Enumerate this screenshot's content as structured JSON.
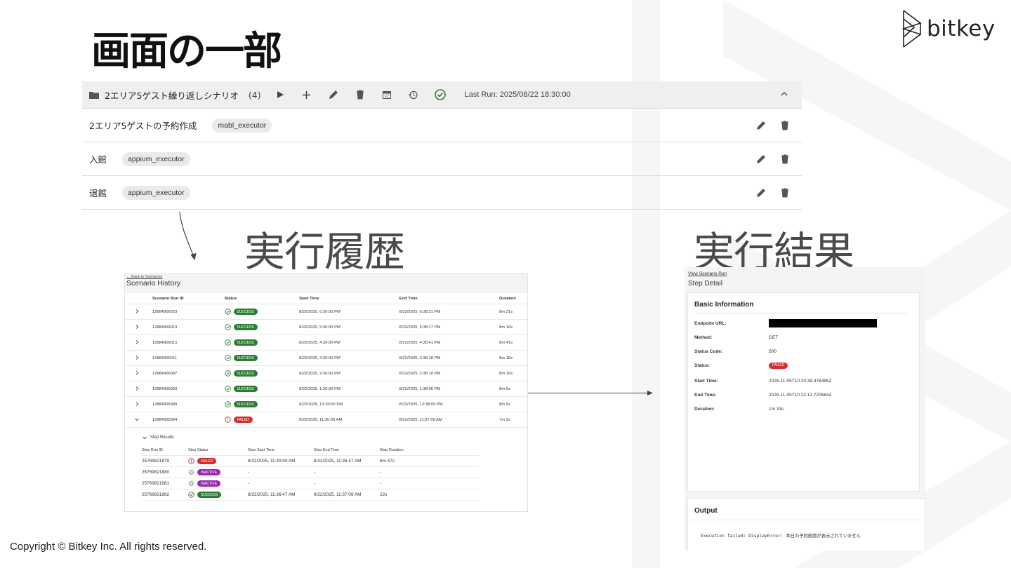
{
  "slide": {
    "title": "画面の一部",
    "logo_text": "bitkey",
    "label_history": "実行履歴",
    "label_result": "実行結果",
    "copyright": "Copyright © Bitkey Inc. All rights reserved."
  },
  "scenario": {
    "group_name": "2エリア5ゲスト繰り返しシナリオ",
    "count": "(4)",
    "last_run": "Last Run: 2025/08/22 18:30:00",
    "rows": [
      {
        "name": "2エリア5ゲストの予約作成",
        "executor": "mabl_executor"
      },
      {
        "name": "入館",
        "executor": "appium_executor"
      },
      {
        "name": "退館",
        "executor": "appium_executor"
      }
    ]
  },
  "history": {
    "back_link": "← Back to Scenarios",
    "title": "Scenario History",
    "columns": [
      "Scenario Run ID",
      "Status",
      "Start Time",
      "End Time",
      "Duration"
    ],
    "rows": [
      {
        "id": "12884906023",
        "status": "SUCCESS",
        "start": "8/22/2025, 6:30:00 PM",
        "end": "8/22/2025, 6:38:21 PM",
        "duration": "8m 21s"
      },
      {
        "id": "12884906019",
        "status": "SUCCESS",
        "start": "8/22/2025, 5:30:00 PM",
        "end": "8/22/2025, 5:38:17 PM",
        "duration": "8m 16s"
      },
      {
        "id": "12884906015",
        "status": "SUCCESS",
        "start": "8/22/2025, 4:30:00 PM",
        "end": "8/22/2025, 4:38:41 PM",
        "duration": "8m 41s"
      },
      {
        "id": "12884906011",
        "status": "SUCCESS",
        "start": "8/22/2025, 3:30:00 PM",
        "end": "8/22/2025, 3:38:18 PM",
        "duration": "8m 18s"
      },
      {
        "id": "12884906007",
        "status": "SUCCESS",
        "start": "8/22/2025, 2:30:00 PM",
        "end": "8/22/2025, 2:38:10 PM",
        "duration": "8m 10s"
      },
      {
        "id": "12884906003",
        "status": "SUCCESS",
        "start": "8/22/2025, 1:30:00 PM",
        "end": "8/22/2025, 1:38:06 PM",
        "duration": "8m 6s"
      },
      {
        "id": "12884905999",
        "status": "SUCCESS",
        "start": "8/22/2025, 12:30:00 PM",
        "end": "8/22/2025, 12:38:09 PM",
        "duration": "8m 9s"
      },
      {
        "id": "12884905994",
        "status": "FAILED",
        "start": "8/22/2025, 11:30:00 AM",
        "end": "8/22/2025, 11:37:09 AM",
        "duration": "7m 9s"
      }
    ],
    "step_results_title": "Step Results",
    "step_columns": [
      "Step Run ID",
      "Step Status",
      "Step Start Time",
      "Step End Time",
      "Step Duration"
    ],
    "steps": [
      {
        "id": "25769821879",
        "status": "FAILED",
        "start": "8/22/2025, 11:30:00 AM",
        "end": "8/22/2025, 11:36:47 AM",
        "duration": "6m 47s"
      },
      {
        "id": "25769821880",
        "status": "INACTIVE",
        "start": "-",
        "end": "-",
        "duration": "-"
      },
      {
        "id": "25769821881",
        "status": "INACTIVE",
        "start": "-",
        "end": "-",
        "duration": "-"
      },
      {
        "id": "25769821882",
        "status": "SUCCESS",
        "start": "8/22/2025, 11:36:47 AM",
        "end": "8/22/2025, 11:37:09 AM",
        "duration": "22s"
      }
    ]
  },
  "detail": {
    "view_link": "View Scenario Run",
    "title": "Step Detail",
    "card_title": "Basic Information",
    "endpoint_label": "Endpoint URL:",
    "method_label": "Method:",
    "method": "GET",
    "status_code_label": "Status Code:",
    "status_code": "500",
    "status_label": "Status:",
    "status": "FAILED",
    "start_label": "Start Time:",
    "start": "2025-11-05T10:20:39.476485Z",
    "end_label": "End Time:",
    "end": "2025-11-05T10:22:12.720584Z",
    "duration_label": "Duration:",
    "duration": "1m 33s",
    "output_title": "Output",
    "output_text": "Execution failed: DisplayError: 本日の予約画面が表示されていません"
  },
  "colors": {
    "success": "#2e7d32",
    "failed": "#d32f2f",
    "inactive": "#9c27b0",
    "header_bg": "#efefef"
  }
}
